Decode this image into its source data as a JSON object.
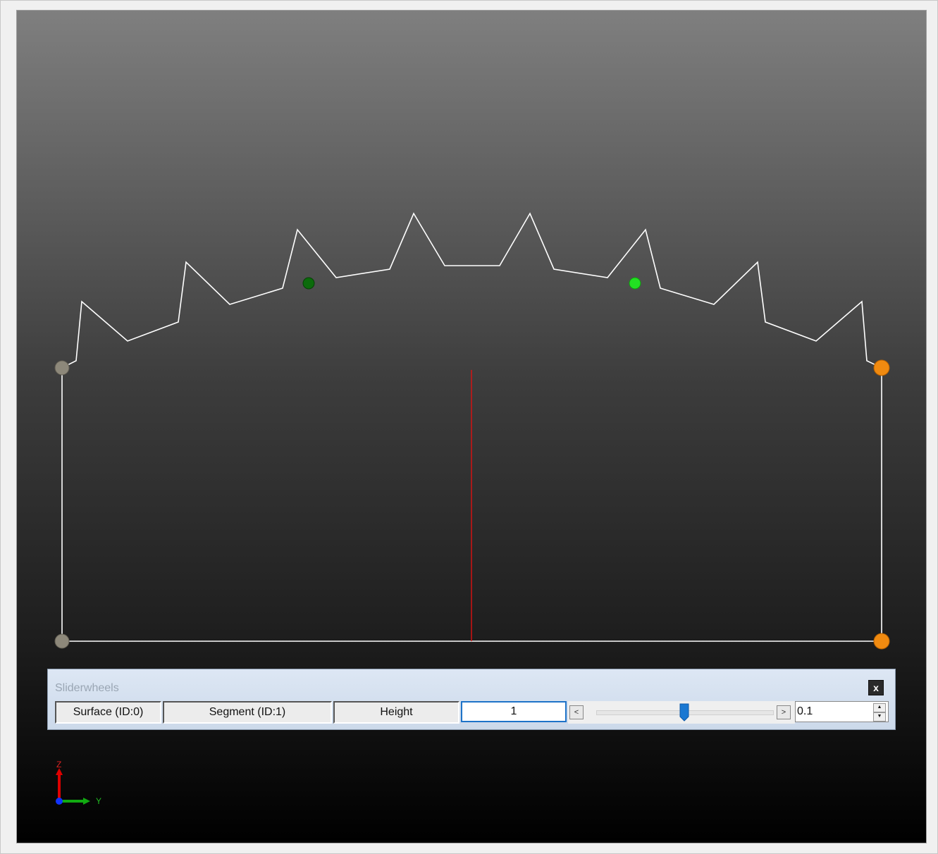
{
  "sliderwheels": {
    "title": "Sliderwheels",
    "close_label": "x",
    "surface_label": "Surface (ID:0)",
    "segment_label": "Segment (ID:1)",
    "parameter_label": "Height",
    "value": "1",
    "decrement_label": "<",
    "increment_label": ">",
    "slider_position": 0.5,
    "step_value": "0.1",
    "spin_up": "▲",
    "spin_down": "▼"
  },
  "axes": {
    "z_label": "Z",
    "y_label": "Y"
  },
  "colors": {
    "profile_line": "#ffffff",
    "center_line": "#dd1111",
    "control_point_dark_green": "#0b6b0b",
    "control_point_green": "#22e022",
    "control_point_gray": "#8d887a",
    "control_point_orange": "#f08a10",
    "axis_z": "#dd0000",
    "axis_y": "#11aa11",
    "axis_x": "#1133ff"
  }
}
